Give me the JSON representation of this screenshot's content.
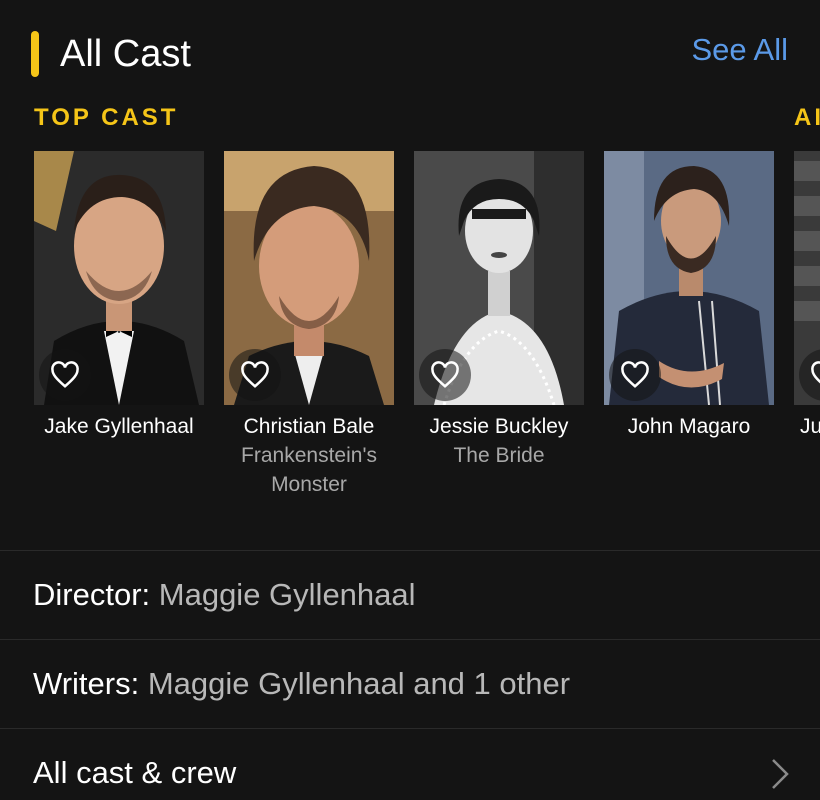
{
  "header": {
    "title": "All Cast",
    "see_all": "See All"
  },
  "top_cast": {
    "heading": "TOP CAST",
    "next_heading_partial": "AI",
    "members": [
      {
        "name": "Jake Gyllenhaal",
        "role": ""
      },
      {
        "name": "Christian Bale",
        "role": "Frankenstein's Monster"
      },
      {
        "name": "Jessie Buckley",
        "role": "The Bride"
      },
      {
        "name": "John Magaro",
        "role": ""
      },
      {
        "name": "Ju",
        "role": ""
      }
    ]
  },
  "director": {
    "label": "Director:",
    "value": "Maggie Gyllenhaal"
  },
  "writers": {
    "label": "Writers:",
    "value": "Maggie Gyllenhaal and 1 other"
  },
  "all_cast_crew": {
    "label": "All cast & crew"
  },
  "colors": {
    "background": "#141414",
    "accent": "#f5c518",
    "link": "#5b9ae8",
    "muted_text": "#a8a8a8"
  }
}
